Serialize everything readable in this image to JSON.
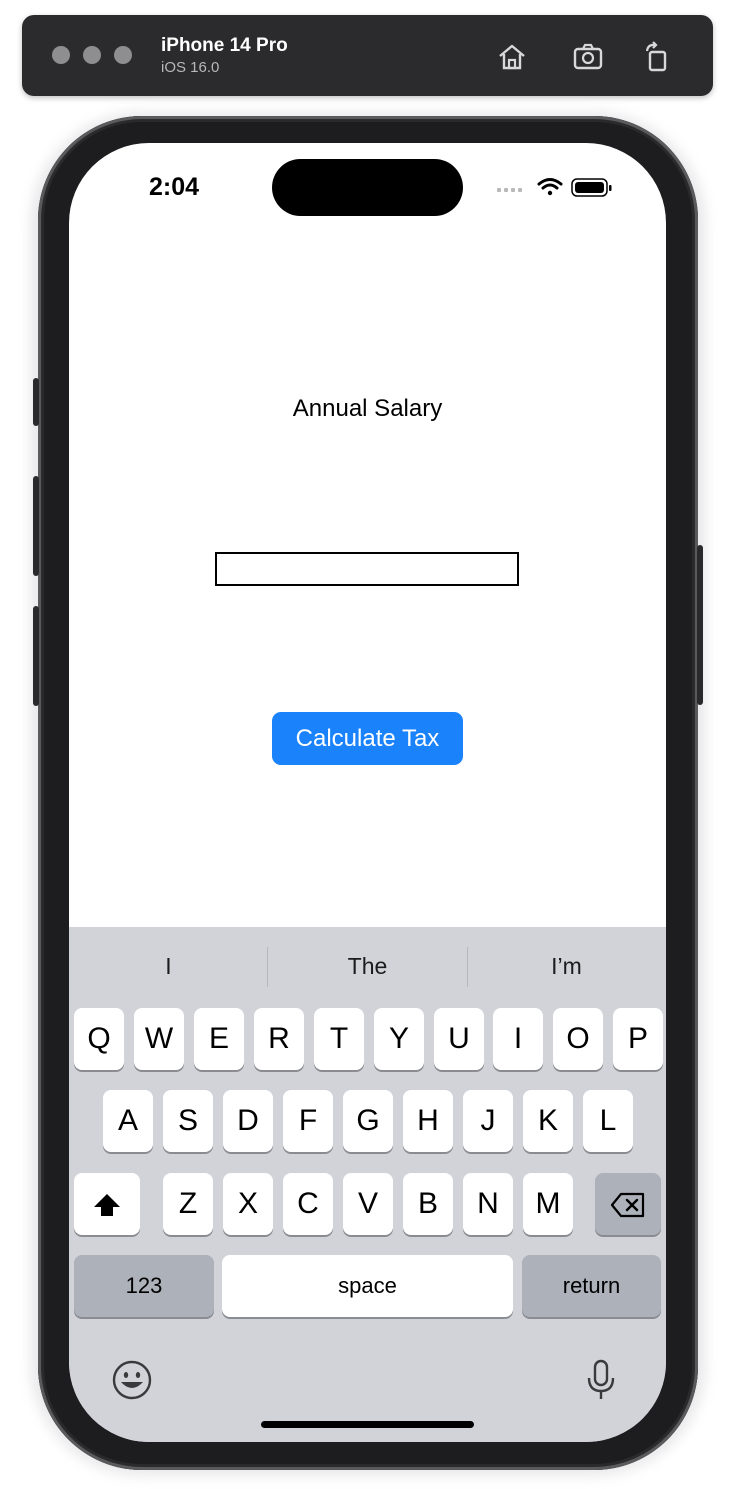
{
  "simulator": {
    "device_name": "iPhone 14 Pro",
    "os_version": "iOS 16.0",
    "icons": [
      "home-icon",
      "screenshot-icon",
      "rotate-icon"
    ]
  },
  "status_bar": {
    "time": "2:04",
    "icons": [
      "cellular-icon",
      "wifi-icon",
      "battery-icon"
    ]
  },
  "app": {
    "label": "Annual Salary",
    "salary_input": {
      "value": "",
      "placeholder": ""
    },
    "calculate_button": "Calculate Tax",
    "accent_color": "#1a82fb"
  },
  "keyboard": {
    "suggestions": [
      "I",
      "The",
      "I’m"
    ],
    "row1": [
      "Q",
      "W",
      "E",
      "R",
      "T",
      "Y",
      "U",
      "I",
      "O",
      "P"
    ],
    "row2": [
      "A",
      "S",
      "D",
      "F",
      "G",
      "H",
      "J",
      "K",
      "L"
    ],
    "row3": [
      "Z",
      "X",
      "C",
      "V",
      "B",
      "N",
      "M"
    ],
    "numbers_key": "123",
    "space_key": "space",
    "return_key": "return",
    "icons": [
      "shift-icon",
      "backspace-icon",
      "emoji-icon",
      "microphone-icon"
    ]
  }
}
